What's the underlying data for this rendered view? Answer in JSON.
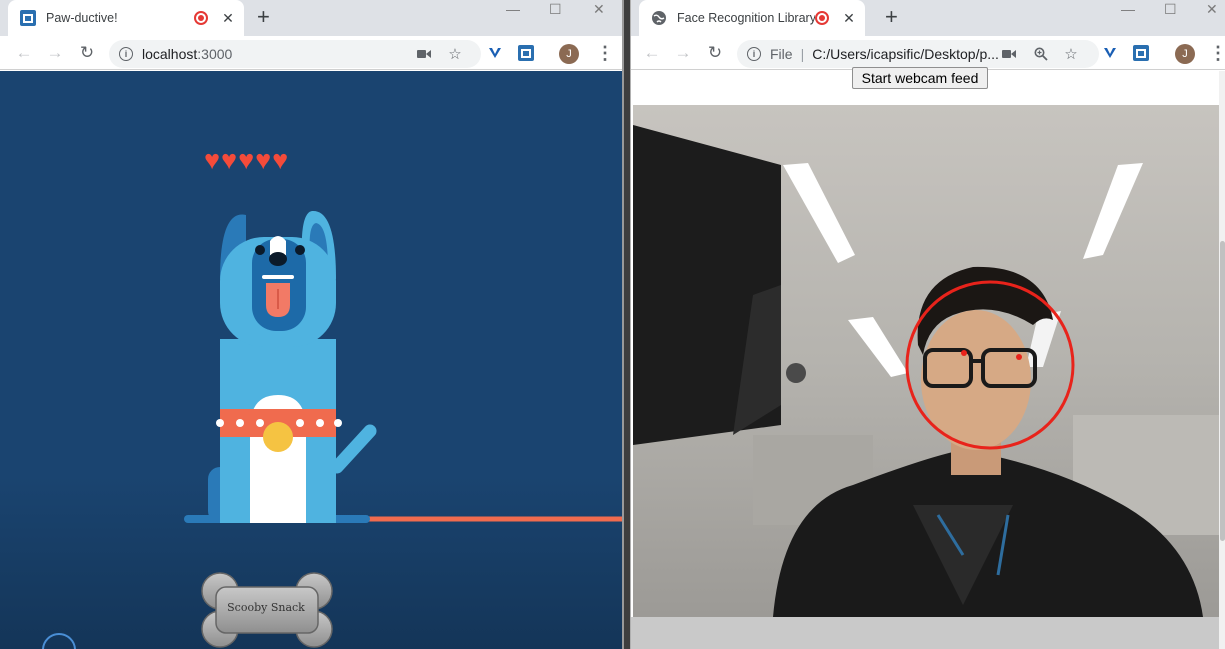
{
  "left_window": {
    "tab_title": "Paw-ductive!",
    "tab_close": "✕",
    "new_tab": "+",
    "url_host": "localhost",
    "url_port": ":3000",
    "profile_initial": "J",
    "hearts": [
      "♥",
      "♥",
      "♥",
      "♥",
      "♥"
    ],
    "bone_label": "Scooby Snack"
  },
  "right_window": {
    "tab_title": "Face Recognition Library",
    "tab_close": "✕",
    "new_tab": "+",
    "url_scheme": "File",
    "url_path": "C:/Users/icapsific/Desktop/p...",
    "profile_initial": "J",
    "webcam_button": "Start webcam feed"
  },
  "colors": {
    "left_background": "#1a4470",
    "dog_body": "#4fb3e0",
    "collar": "#f06b4e",
    "heart": "#f44b3a",
    "face_circle": "#e8231b"
  }
}
